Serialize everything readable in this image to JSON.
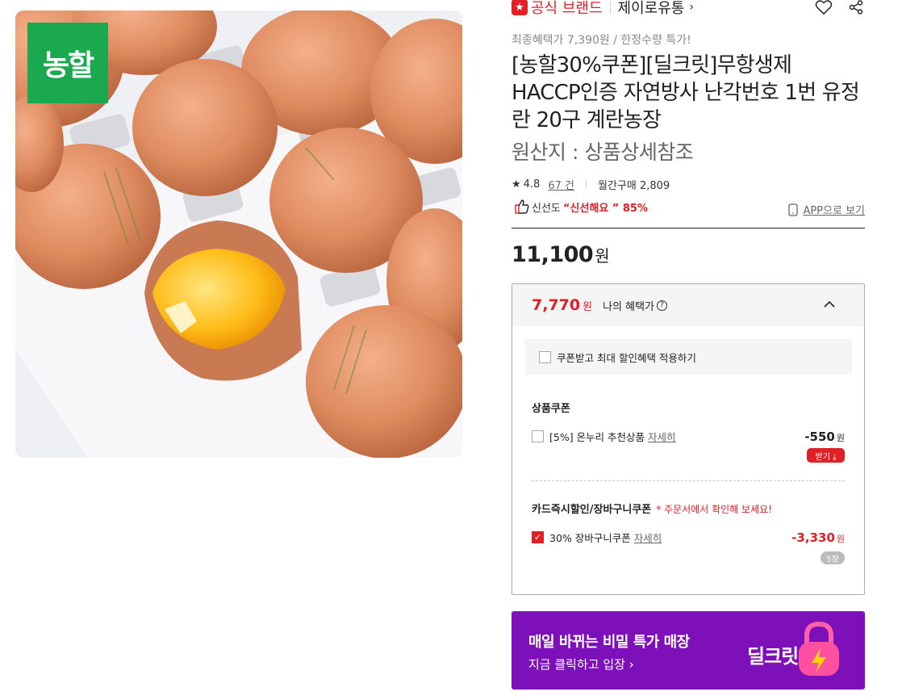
{
  "image": {
    "logo_text": "농할"
  },
  "header": {
    "official_brand": "공식 브랜드",
    "seller_name": "제이로유통",
    "seller_chevron": "›"
  },
  "product": {
    "promo_text": "최종혜택가 7,390원 / 한정수량 특가!",
    "title": "[농할30%쿠폰][딜크릿]무항생제 HACCP인증 자연방사 난각번호 1번 유정란 20구 계란농장",
    "origin": "원산지 : 상품상세참조",
    "rating": "4.8",
    "review_count": "67 건",
    "monthly_purchase": "월간구매 2,809",
    "freshness_label": "신선도",
    "freshness_value": "“신선해요 ” 85%",
    "app_view": "APP으로 보기",
    "price": "11,100",
    "price_unit": "원"
  },
  "benefit": {
    "amount": "7,770",
    "amount_unit": "원",
    "label": "나의 혜택가",
    "help_mark": "?",
    "max_apply_label": "쿠폰받고 최대 할인혜택 적용하기",
    "product_coupon_title": "상품쿠폰",
    "product_coupon": {
      "name": "[5%] 온누리 추천상품",
      "detail": "자세히",
      "discount": "-550",
      "unit": "원",
      "download": "받기 ⤓"
    },
    "card_section_title": "카드즉시할인/장바구니쿠폰",
    "card_section_note": "* 주문서에서 확인해 보세요!",
    "cart_coupon": {
      "name": "30% 장바구니쿠폰",
      "detail": "자세히",
      "discount": "-3,330",
      "unit": "원",
      "count": "5장",
      "checked": true
    }
  },
  "deal_banner": {
    "title": "매일 바뀌는 비밀 특가 매장",
    "subtitle": "지금 클릭하고 입장 ›",
    "logo": "딜크릿"
  },
  "colors": {
    "accent_red": "#e01f26",
    "brand_green": "#1aa94f",
    "banner_purple": "#7d10b8"
  }
}
